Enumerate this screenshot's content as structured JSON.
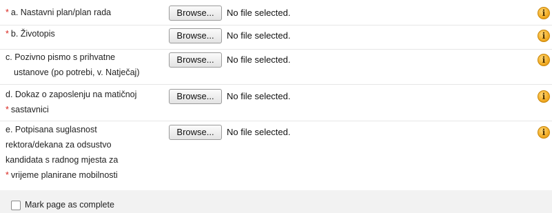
{
  "uploads": [
    {
      "label_lines": [
        {
          "required": true,
          "text": "a. Nastavni plan/plan rada"
        }
      ],
      "browse_label": "Browse...",
      "file_status": "No file selected.",
      "info_icon": "info-icon"
    },
    {
      "label_lines": [
        {
          "required": true,
          "text": "b. Životopis"
        }
      ],
      "browse_label": "Browse...",
      "file_status": "No file selected.",
      "info_icon": "info-icon"
    },
    {
      "label_lines": [
        {
          "required": false,
          "text": "c. Pozivno pismo s prihvatne"
        },
        {
          "required": false,
          "text": "ustanove (po potrebi, v. Natječaj)"
        }
      ],
      "browse_label": "Browse...",
      "file_status": "No file selected.",
      "info_icon": "info-icon"
    },
    {
      "label_lines": [
        {
          "required": false,
          "text": "d. Dokaz o zaposlenju na matičnoj"
        },
        {
          "required": true,
          "text": "sastavnici"
        }
      ],
      "browse_label": "Browse...",
      "file_status": "No file selected.",
      "info_icon": "info-icon"
    },
    {
      "label_lines": [
        {
          "required": false,
          "text": "e. Potpisana suglasnost"
        },
        {
          "required": false,
          "text": "rektora/dekana za odsustvo"
        },
        {
          "required": false,
          "text": "kandidata s radnog mjesta za"
        },
        {
          "required": true,
          "text": "vrijeme planirane mobilnosti"
        }
      ],
      "browse_label": "Browse...",
      "file_status": "No file selected.",
      "info_icon": "info-icon"
    }
  ],
  "required_marker": "*",
  "info_glyph": "i",
  "footer": {
    "checkbox_label": "Mark page as complete",
    "checked": false
  },
  "colors": {
    "required": "#d9251d",
    "info_icon": "#f2ac25",
    "footer_bg": "#f2f2f2"
  }
}
